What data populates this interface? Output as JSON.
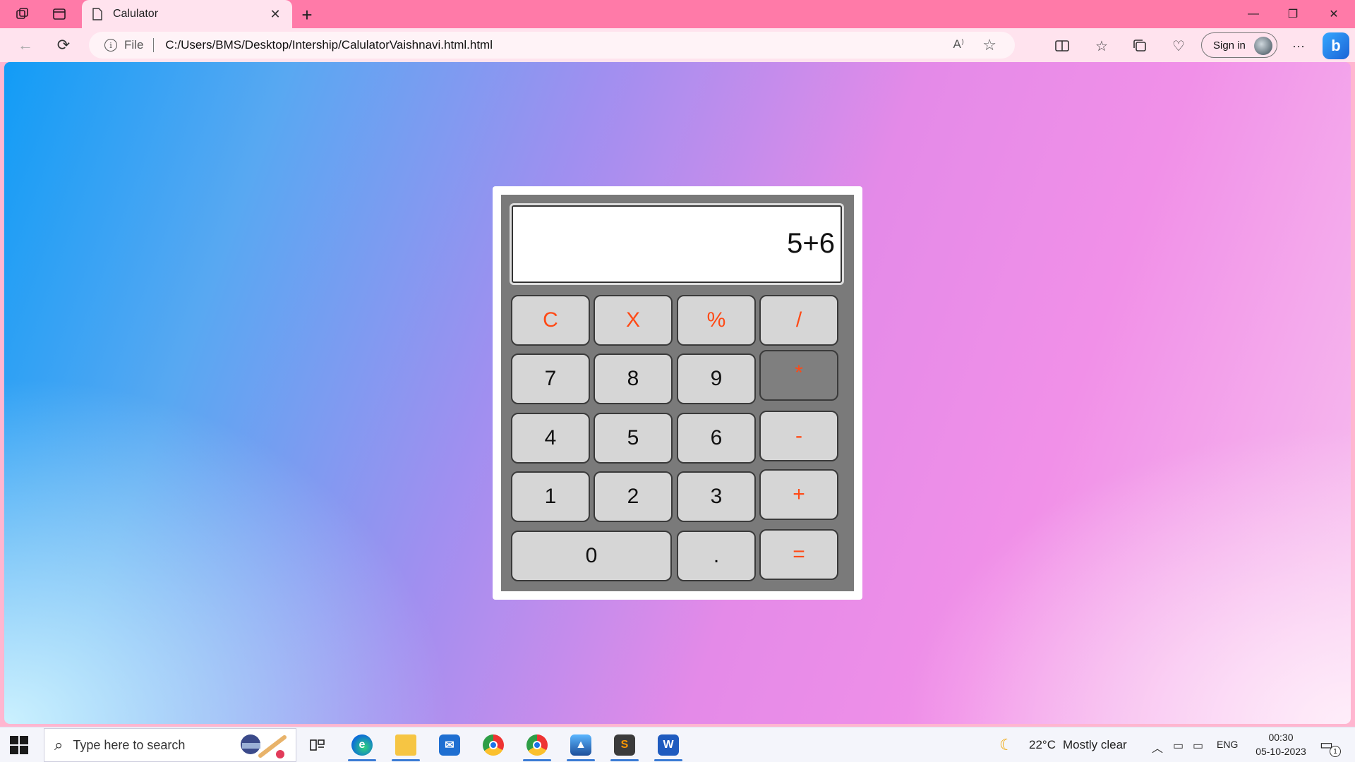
{
  "browser": {
    "tab_title": "Calulator",
    "close_glyph": "✕",
    "new_tab_glyph": "+",
    "address": {
      "scheme_label": "File",
      "url": "C:/Users/BMS/Desktop/Intership/CalulatorVaishnavi.html.html"
    },
    "sign_in_label": "Sign in",
    "copilot_glyph": "b",
    "window_controls": {
      "minimize": "—",
      "restore": "❐",
      "close": "✕"
    }
  },
  "calculator": {
    "display_value": "5+6",
    "keys": {
      "clear": "C",
      "backspace": "X",
      "percent": "%",
      "divide": "/",
      "seven": "7",
      "eight": "8",
      "nine": "9",
      "multiply": "*",
      "four": "4",
      "five": "5",
      "six": "6",
      "minus": "-",
      "one": "1",
      "two": "2",
      "three": "3",
      "plus": "+",
      "zero": "0",
      "decimal": ".",
      "equals": "="
    },
    "pressed_key": "multiply",
    "colors": {
      "operator": "#ff4a16",
      "body": "#7a7a7a",
      "key": "#d6d6d6"
    }
  },
  "taskbar": {
    "search_placeholder": "Type here to search",
    "weather": {
      "temp": "22°C",
      "condition": "Mostly clear"
    },
    "language": "ENG",
    "time": "00:30",
    "date": "05-10-2023",
    "notification_count": "1",
    "apps": [
      "task-view",
      "edge",
      "file-explorer",
      "mail",
      "chrome",
      "chrome",
      "photos",
      "sublime-text",
      "word"
    ]
  }
}
